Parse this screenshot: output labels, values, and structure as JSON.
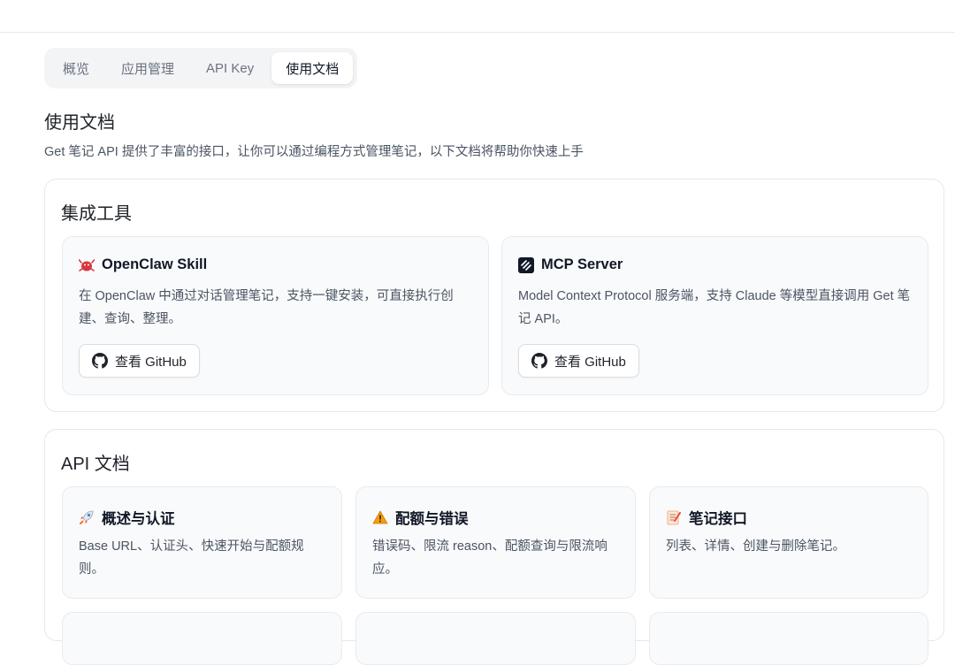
{
  "tabs": [
    {
      "label": "概览"
    },
    {
      "label": "应用管理"
    },
    {
      "label": "API Key"
    },
    {
      "label": "使用文档",
      "active": true
    }
  ],
  "page": {
    "title": "使用文档",
    "description": "Get 笔记 API 提供了丰富的接口，让你可以通过编程方式管理笔记，以下文档将帮助你快速上手"
  },
  "integrations": {
    "title": "集成工具",
    "cards": [
      {
        "icon": "openclaw-icon",
        "title": "OpenClaw Skill",
        "description": "在 OpenClaw 中通过对话管理笔记，支持一键安装，可直接执行创建、查询、整理。",
        "button": "查看 GitHub"
      },
      {
        "icon": "mcp-icon",
        "title": "MCP Server",
        "description": "Model Context Protocol 服务端，支持 Claude 等模型直接调用 Get 笔记 API。",
        "button": "查看 GitHub"
      }
    ]
  },
  "api_docs": {
    "title": "API 文档",
    "cards": [
      {
        "icon": "rocket-icon",
        "title": "概述与认证",
        "description": "Base URL、认证头、快速开始与配额规则。"
      },
      {
        "icon": "warning-icon",
        "title": "配额与错误",
        "description": "错误码、限流 reason、配额查询与限流响应。"
      },
      {
        "icon": "memo-icon",
        "title": "笔记接口",
        "description": "列表、详情、创建与删除笔记。"
      }
    ]
  },
  "colors": {
    "accent_dark": "#111827",
    "border": "#e5e7eb",
    "card_bg": "#f9fafb",
    "warning": "#f59e0b",
    "openclaw_red": "#d9363e"
  }
}
